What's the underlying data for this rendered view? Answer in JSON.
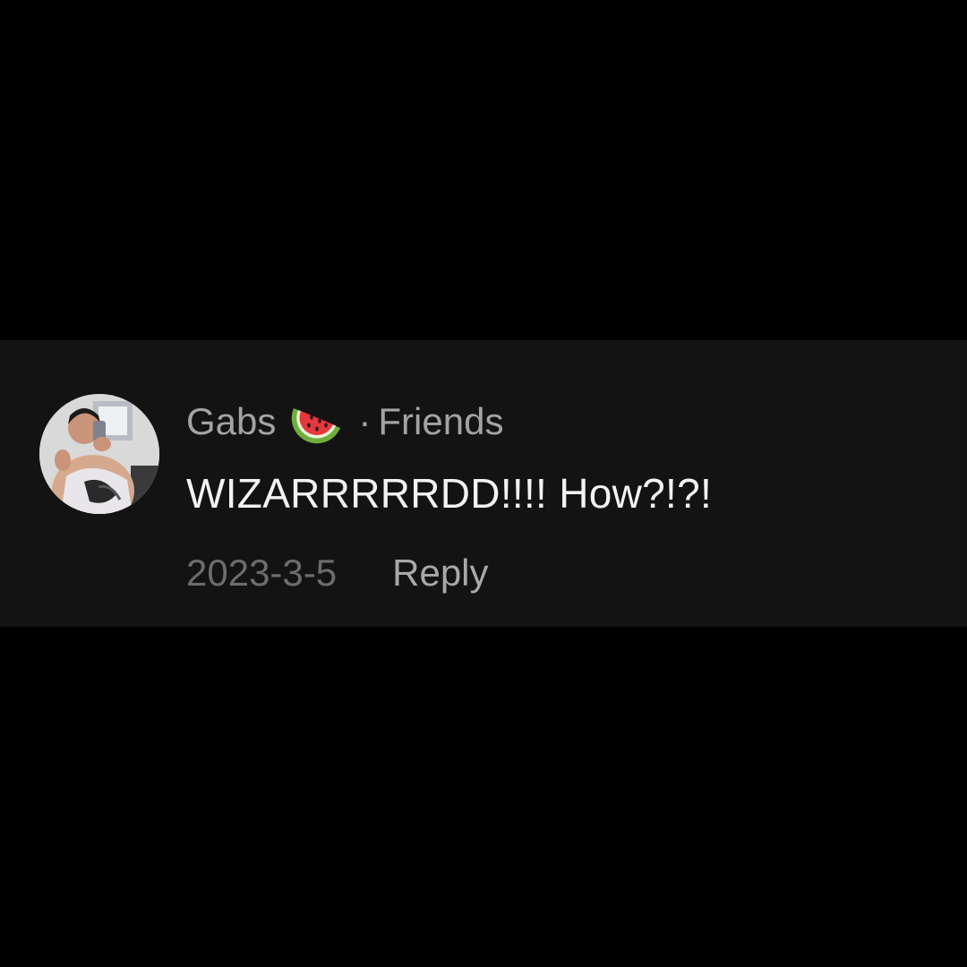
{
  "comment": {
    "username": "Gabs",
    "name_emoji": "watermelon-icon",
    "separator": "·",
    "relation": "Friends",
    "text": "WIZARRRRRDD!!!! How?!?!",
    "timestamp": "2023-3-5",
    "reply_label": "Reply"
  },
  "colors": {
    "page_background": "#000000",
    "card_background": "#131313",
    "primary_text": "#f2f2f2",
    "secondary_text": "#a3a3a3",
    "timestamp_text": "#6c6c6c"
  }
}
